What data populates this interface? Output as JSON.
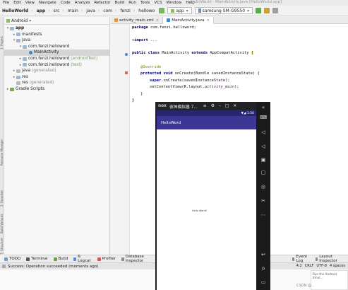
{
  "menubar": {
    "items": [
      "File",
      "Edit",
      "View",
      "Navigate",
      "Code",
      "Analyze",
      "Refactor",
      "Build",
      "Run",
      "Tools",
      "VCS",
      "Window",
      "Help"
    ],
    "window_title": "HelloWorld - MainActivity.java [HelloWorld.app]"
  },
  "navbar": {
    "crumbs": [
      "HelloWorld",
      "app",
      "src",
      "main",
      "java",
      "com",
      "fenzi",
      "hellowo"
    ],
    "run_config": "app",
    "device": "samsung SM-G9550"
  },
  "project": {
    "view_label": "Android",
    "tree": [
      {
        "label": "app",
        "arrow": "▾",
        "icon": "folder",
        "bold": true
      },
      {
        "label": "manifests",
        "arrow": "▸",
        "icon": "folder"
      },
      {
        "label": "java",
        "arrow": "▾",
        "icon": "folder"
      },
      {
        "label": "com.fenzi.helloword",
        "arrow": "▾",
        "icon": "folder"
      },
      {
        "label": "MainActivity",
        "arrow": "",
        "icon": "class",
        "selected": true
      },
      {
        "label": "com.fenzi.helloword",
        "suffix": "(androidTest)",
        "arrow": "▸",
        "icon": "folder"
      },
      {
        "label": "com.fenzi.helloword",
        "suffix": "(test)",
        "arrow": "▸",
        "icon": "folder"
      },
      {
        "label": "java",
        "suffix": "(generated)",
        "arrow": "▸",
        "icon": "gray-folder"
      },
      {
        "label": "res",
        "arrow": "▸",
        "icon": "folder"
      },
      {
        "label": "res",
        "suffix": "(generated)",
        "arrow": "",
        "icon": "gray-folder"
      },
      {
        "label": "Gradle Scripts",
        "arrow": "▸",
        "icon": "gradle"
      }
    ]
  },
  "left_strip": {
    "labels": [
      "1: Project",
      "Resource Manager",
      "2: Favorites",
      "Build Variants",
      "7: Structure"
    ]
  },
  "editor": {
    "tabs": [
      {
        "label": "activity_main.xml",
        "active": false
      },
      {
        "label": "MainActivity.java",
        "active": true
      }
    ],
    "lines": {
      "l1_kw": "package",
      "l1_rest": " com.fenzi.helloword;",
      "l2_kw": "import",
      "l2_rest": " ...",
      "l3_kw1": "public class",
      "l3_rest1": " MainActivity ",
      "l3_kw2": "extends",
      "l3_rest2": " AppCompatActivity ",
      "l3_brace": "{",
      "l4": "@Override",
      "l5_kw": "protected void",
      "l5_rest": " onCreate(Bundle savedInstanceState) {",
      "l6_kw": "super",
      "l6_rest": ".onCreate(savedInstanceState);",
      "l7_a": "setContentView(R.layout.",
      "l7_b": "activity_main",
      "l7_c": ");",
      "l8": "}",
      "l9": "}"
    }
  },
  "bottom_tabs": [
    "TODO",
    "Terminal",
    "Build",
    "6: Logcat",
    "Profiler",
    "Database Inspector",
    "Event Log",
    "Layout Inspector"
  ],
  "status": {
    "message": "Success: Operation succeeded (moments ago)",
    "right": [
      "4:2",
      "CRLF",
      "UTF-8",
      "4 spaces"
    ]
  },
  "emulator": {
    "brand": "nox",
    "title": "夜神模拟器 7...",
    "status_right": "▼◢ 1:56",
    "app_title": "HelloWord",
    "body_text": "Hello World!",
    "side_icons": [
      "collapse-icon",
      "keyboard-icon",
      "volume-up-icon",
      "volume-down-icon",
      "screen-icon",
      "add-apk-icon",
      "location-icon",
      "scissors-icon",
      "more-icon",
      "back-icon",
      "home-icon",
      "recents-icon"
    ]
  },
  "notification": {
    "text": "Run the Android Emul..."
  },
  "watermark": "CSDN @..."
}
